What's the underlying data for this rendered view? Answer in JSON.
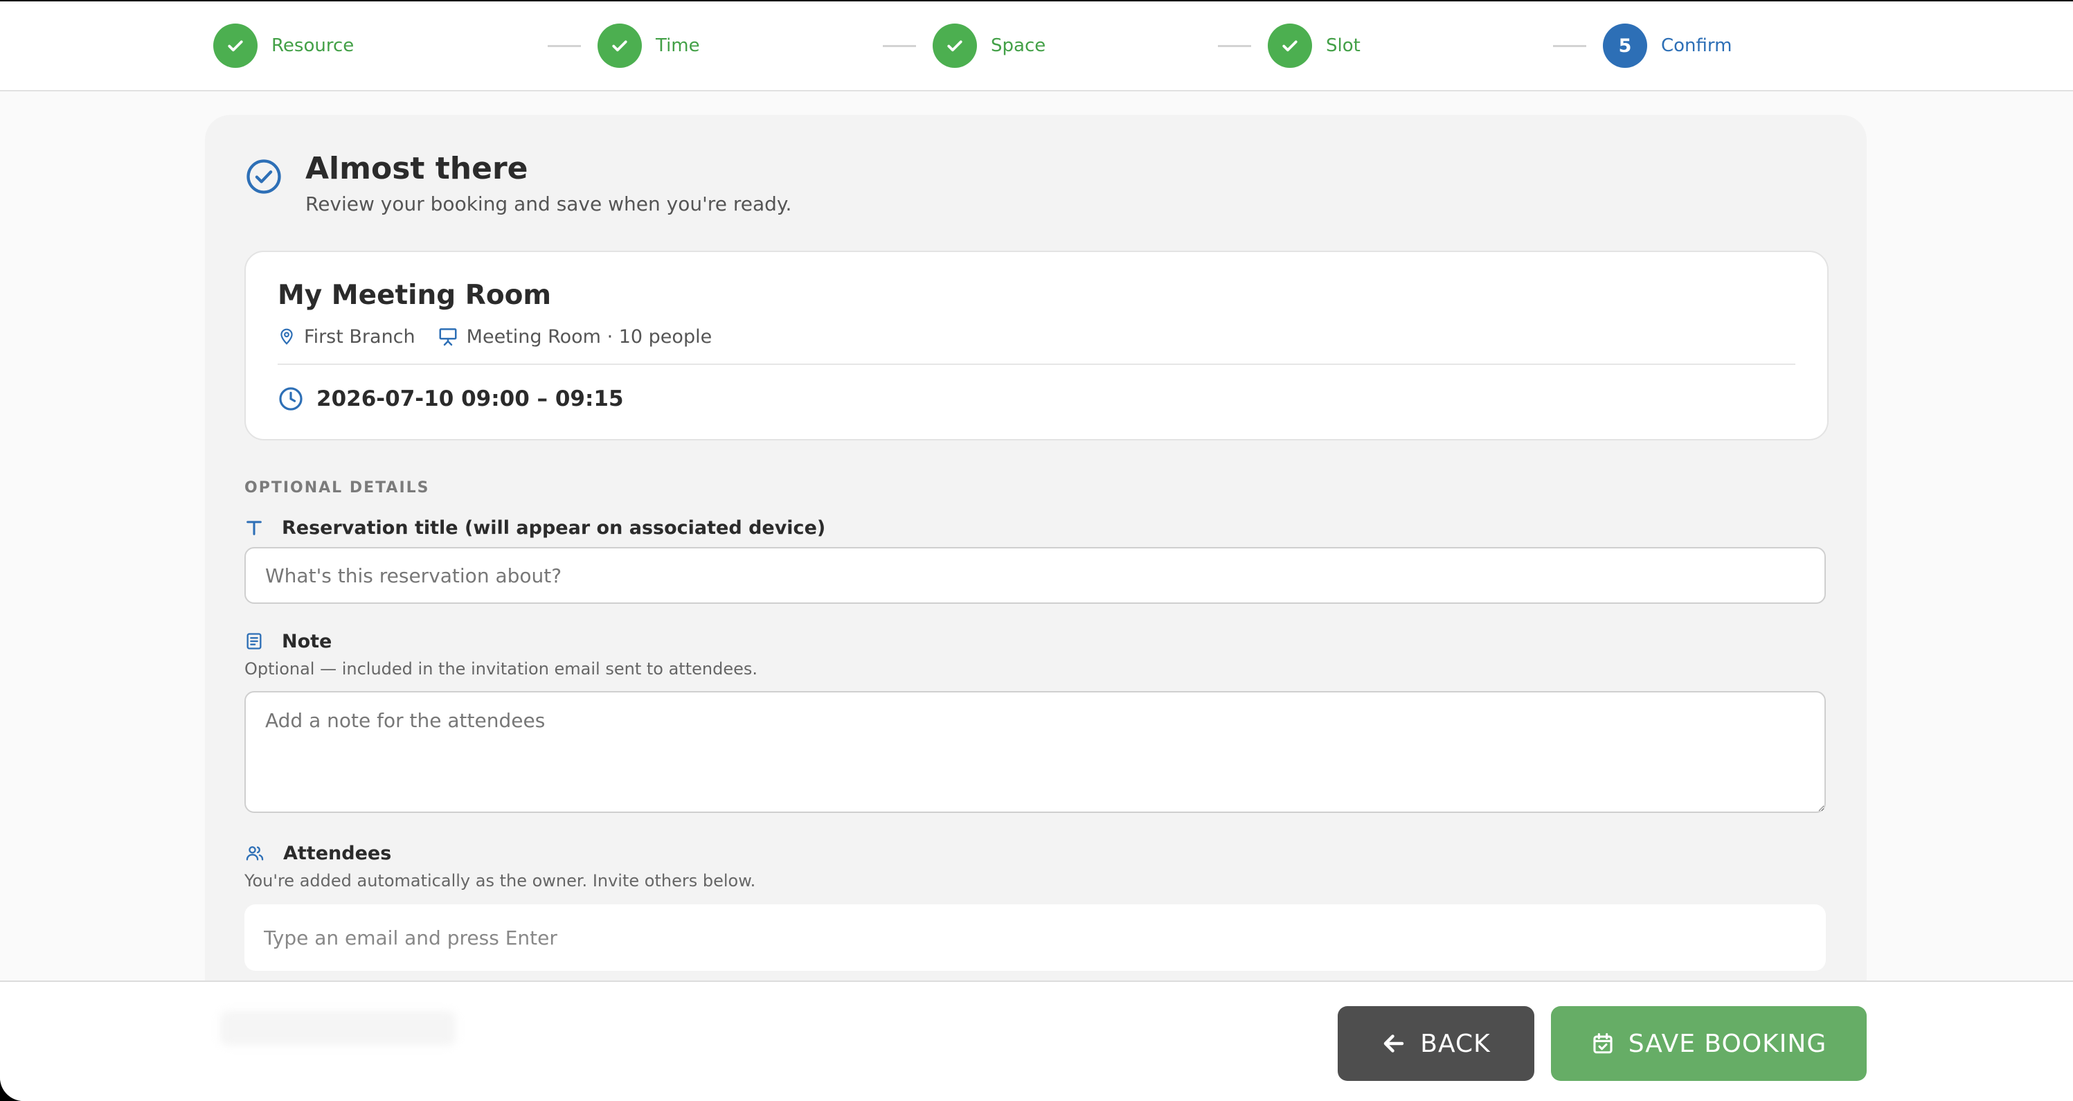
{
  "stepper": {
    "steps": [
      {
        "label": "Resource",
        "state": "done"
      },
      {
        "label": "Time",
        "state": "done"
      },
      {
        "label": "Space",
        "state": "done"
      },
      {
        "label": "Slot",
        "state": "done"
      },
      {
        "label": "Confirm",
        "state": "active",
        "number": "5"
      }
    ]
  },
  "header": {
    "title": "Almost there",
    "subtitle": "Review your booking and save when you're ready."
  },
  "summary": {
    "room_name": "My Meeting Room",
    "location": "First Branch",
    "room_info": "Meeting Room · 10 people",
    "datetime": "2026-07-10 09:00 – 09:15"
  },
  "optional": {
    "section_label": "OPTIONAL DETAILS",
    "reservation_title": {
      "label": "Reservation title (will appear on associated device)",
      "placeholder": "What's this reservation about?"
    },
    "note": {
      "label": "Note",
      "help": "Optional — included in the invitation email sent to attendees.",
      "placeholder": "Add a note for the attendees"
    },
    "attendees": {
      "label": "Attendees",
      "help": "You're added automatically as the owner. Invite others below.",
      "placeholder": "Type an email and press Enter"
    }
  },
  "footer": {
    "back_label": "BACK",
    "save_label": "SAVE BOOKING"
  },
  "colors": {
    "success": "#4caf50",
    "primary": "#2d6fb6",
    "save_button": "#66ad66",
    "back_button": "#4e4e4e"
  }
}
